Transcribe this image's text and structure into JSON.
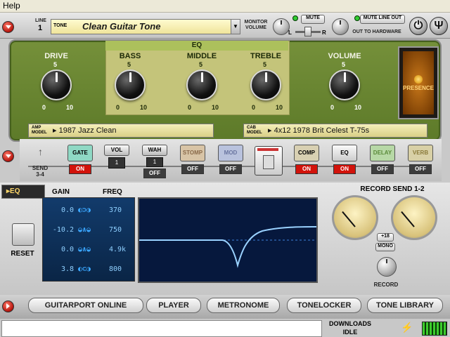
{
  "menu": {
    "help": "Help"
  },
  "topbar": {
    "line_label": "LINE",
    "line_number": "1",
    "tone_tag": "TONE",
    "tone_name": "Clean Guitar Tone",
    "monitor_volume": "MONITOR VOLUME",
    "mute": "MUTE",
    "l": "L",
    "r": "R",
    "mute_line_out": "MUTE LINE OUT",
    "out_to_hardware": "OUT TO HARDWARE"
  },
  "amp": {
    "eq_header": "EQ",
    "knobs": [
      {
        "label": "DRIVE",
        "min": "0",
        "mid": "5",
        "max": "10"
      },
      {
        "label": "BASS",
        "min": "0",
        "mid": "5",
        "max": "10"
      },
      {
        "label": "MIDDLE",
        "min": "0",
        "mid": "5",
        "max": "10"
      },
      {
        "label": "TREBLE",
        "min": "0",
        "mid": "5",
        "max": "10"
      },
      {
        "label": "VOLUME",
        "min": "0",
        "mid": "5",
        "max": "10"
      }
    ],
    "amp_model_tag": "AMP MODEL",
    "amp_model": "1987 Jazz Clean",
    "cab_model_tag": "CAB MODEL",
    "cab_model": "4x12 1978 Brit Celest T-75s",
    "presence": "PRESENCE"
  },
  "fx": {
    "send_label": "SEND",
    "send_channel": "3-4",
    "vol_position": "1",
    "wah_position": "1",
    "units": [
      {
        "label": "GATE",
        "state": "ON"
      },
      {
        "label": "VOL",
        "state": ""
      },
      {
        "label": "WAH",
        "state": "OFF"
      },
      {
        "label": "STOMP",
        "state": "OFF"
      },
      {
        "label": "MOD",
        "state": "OFF"
      },
      {
        "label": "",
        "state": ""
      },
      {
        "label": "COMP",
        "state": "ON"
      },
      {
        "label": "EQ",
        "state": "ON"
      },
      {
        "label": "DELAY",
        "state": "OFF"
      },
      {
        "label": "VERB",
        "state": "OFF"
      }
    ]
  },
  "eq": {
    "tab": "EQ",
    "gain_header": "GAIN",
    "freq_header": "FREQ",
    "reset": "RESET",
    "rows": [
      {
        "gain": "0.0",
        "freq": "370"
      },
      {
        "gain": "-10.2",
        "freq": "750"
      },
      {
        "gain": "0.0",
        "freq": "4.9k"
      },
      {
        "gain": "3.8",
        "freq": "800"
      }
    ]
  },
  "record": {
    "title": "RECORD SEND 1-2",
    "boost": "+18",
    "mono": "MONO",
    "record_label": "RECORD"
  },
  "nav": {
    "buttons": [
      "GUITARPORT ONLINE",
      "PLAYER",
      "METRONOME",
      "TONELOCKER",
      "TONE LIBRARY"
    ]
  },
  "status": {
    "downloads": "DOWNLOADS",
    "downloads_state": "IDLE"
  }
}
